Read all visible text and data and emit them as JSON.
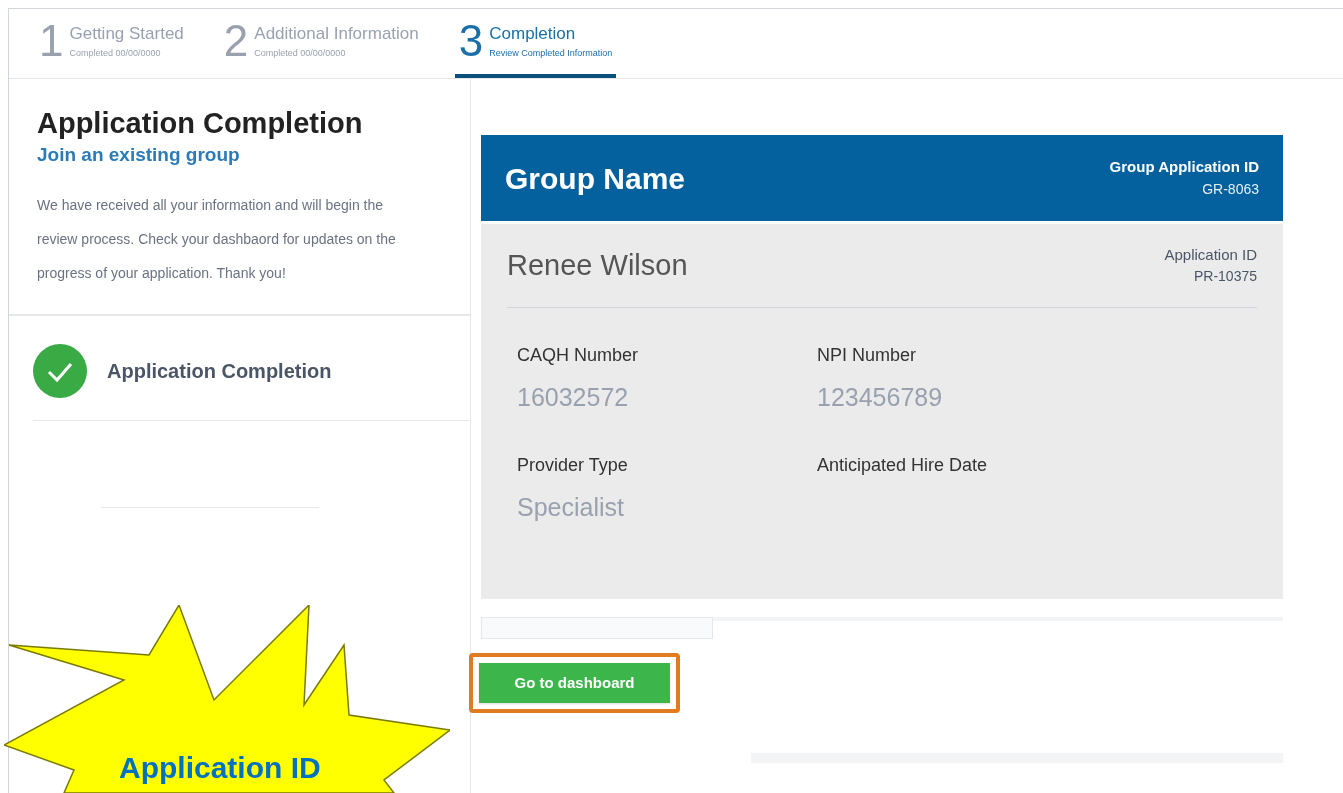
{
  "steps": [
    {
      "number": "1",
      "title": "Getting Started",
      "subtitle": "Completed 00/00/0000",
      "selected": false
    },
    {
      "number": "2",
      "title": "Additional Information",
      "subtitle": "Completed 00/00/0000",
      "selected": false
    },
    {
      "number": "3",
      "title": "Completion",
      "subtitle": "Review Completed Information",
      "selected": true
    }
  ],
  "sidebar": {
    "title": "Application Completion",
    "subtitle": "Join an existing group",
    "message": "We have received all your information and will begin the review process. Check your dashbaord for updates on the progress of your application. Thank you!",
    "status_items": [
      {
        "label": "Application Completion",
        "checked": true
      }
    ]
  },
  "card": {
    "group_name": "Group Name",
    "group_id_label": "Group Application ID",
    "group_id": "GR-8063",
    "person_name": "Renee Wilson",
    "app_id_label": "Application ID",
    "app_id": "PR-10375",
    "fields": [
      {
        "label": "CAQH Number",
        "value": "16032572"
      },
      {
        "label": "NPI Number",
        "value": "123456789"
      },
      {
        "label": "Provider Type",
        "value": "Specialist"
      },
      {
        "label": "Anticipated Hire Date"
      }
    ]
  },
  "button": {
    "label": "Go to dashboard",
    "highlighted": true
  },
  "callout": {
    "text": "Application ID"
  }
}
